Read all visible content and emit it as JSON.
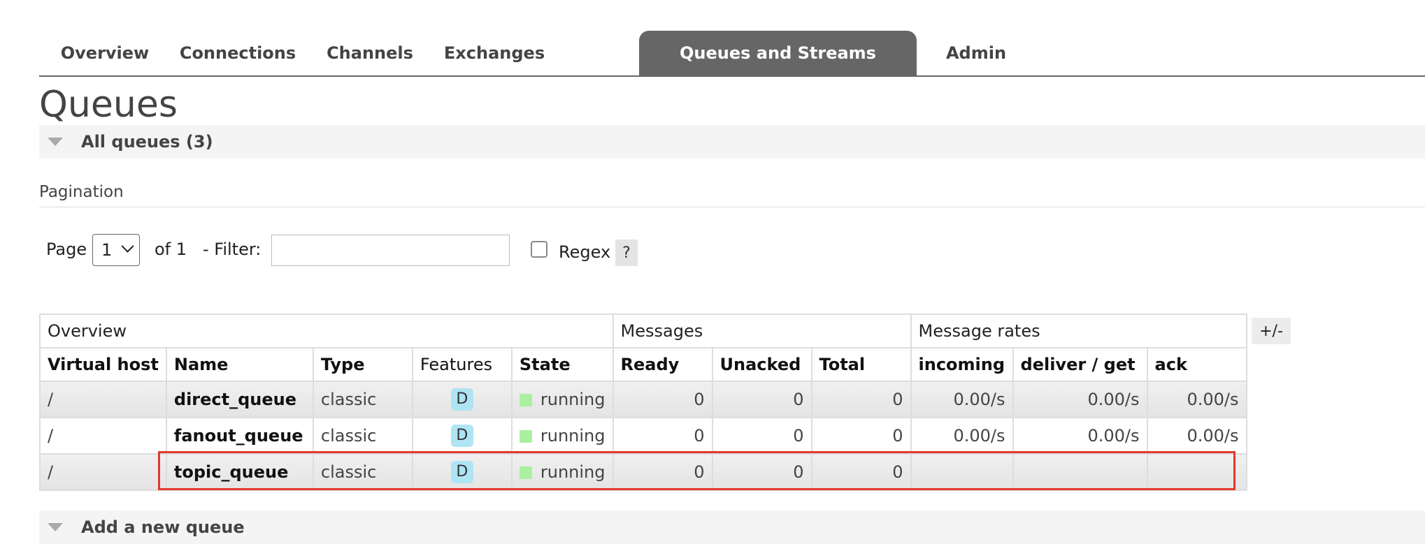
{
  "tabs": [
    "Overview",
    "Connections",
    "Channels",
    "Exchanges",
    "Queues and Streams",
    "Admin"
  ],
  "active_tab": "Queues and Streams",
  "page_title": "Queues",
  "all_queues_label": "All queues (3)",
  "pagination": {
    "heading": "Pagination",
    "page_label": "Page",
    "page_value": "1",
    "of_label": "of 1",
    "filter_label": "- Filter:",
    "filter_value": "",
    "regex_label": "Regex",
    "regex_checked": false,
    "help_label": "?"
  },
  "table": {
    "groups": [
      "Overview",
      "Messages",
      "Message rates"
    ],
    "columns": [
      "Virtual host",
      "Name",
      "Type",
      "Features",
      "State",
      "Ready",
      "Unacked",
      "Total",
      "incoming",
      "deliver / get",
      "ack"
    ],
    "plus_minus_label": "+/-",
    "rows": [
      {
        "vhost": "/",
        "name": "direct_queue",
        "type": "classic",
        "feature": "D",
        "state": "running",
        "ready": "0",
        "unacked": "0",
        "total": "0",
        "incoming": "0.00/s",
        "deliver_get": "0.00/s",
        "ack": "0.00/s"
      },
      {
        "vhost": "/",
        "name": "fanout_queue",
        "type": "classic",
        "feature": "D",
        "state": "running",
        "ready": "0",
        "unacked": "0",
        "total": "0",
        "incoming": "0.00/s",
        "deliver_get": "0.00/s",
        "ack": "0.00/s"
      },
      {
        "vhost": "/",
        "name": "topic_queue",
        "type": "classic",
        "feature": "D",
        "state": "running",
        "ready": "0",
        "unacked": "0",
        "total": "0",
        "incoming": "",
        "deliver_get": "",
        "ack": ""
      }
    ]
  },
  "add_queue_label": "Add a new queue",
  "colors": {
    "tab_active_bg": "#666666",
    "feature_badge": "#aee4f3",
    "running_indicator": "#aaf0a0",
    "highlight_border": "#e0392b"
  }
}
